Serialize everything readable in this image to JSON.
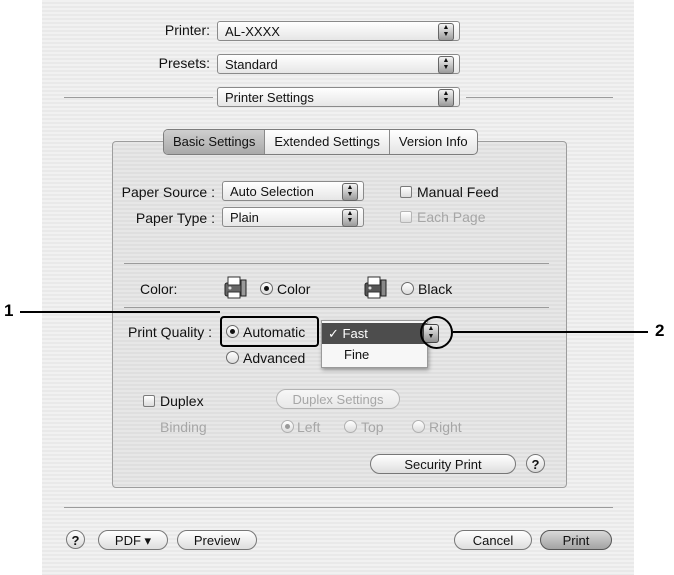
{
  "top": {
    "printer_label": "Printer:",
    "printer_value": "AL-XXXX",
    "presets_label": "Presets:",
    "presets_value": "Standard",
    "pane_value": "Printer Settings"
  },
  "tabs": [
    {
      "label": "Basic Settings",
      "active": true
    },
    {
      "label": "Extended Settings",
      "active": false
    },
    {
      "label": "Version Info",
      "active": false
    }
  ],
  "paper": {
    "source_label": "Paper Source :",
    "source_value": "Auto Selection",
    "type_label": "Paper Type :",
    "type_value": "Plain",
    "manual_feed_label": "Manual Feed",
    "each_page_label": "Each Page"
  },
  "color": {
    "label": "Color:",
    "color_option": "Color",
    "black_option": "Black",
    "selected": "Color"
  },
  "quality": {
    "label": "Print Quality :",
    "automatic_label": "Automatic",
    "advanced_label": "Advanced",
    "selected": "Automatic",
    "menu_items": [
      "Fast",
      "Fine"
    ],
    "menu_selected": "Fast",
    "check_mark": "✓"
  },
  "duplex": {
    "checkbox_label": "Duplex",
    "settings_button": "Duplex Settings",
    "binding_label": "Binding",
    "binding_options": [
      "Left",
      "Top",
      "Right"
    ],
    "binding_selected": "Left"
  },
  "security_button": "Security Print",
  "help_glyph": "?",
  "bottom": {
    "pdf_button": "PDF ▾",
    "preview_button": "Preview",
    "cancel_button": "Cancel",
    "print_button": "Print"
  },
  "callouts": {
    "one": "1",
    "two": "2"
  },
  "colors": {
    "menu_highlight": "#4d4d4d",
    "dialog_bg": "#efefef"
  }
}
